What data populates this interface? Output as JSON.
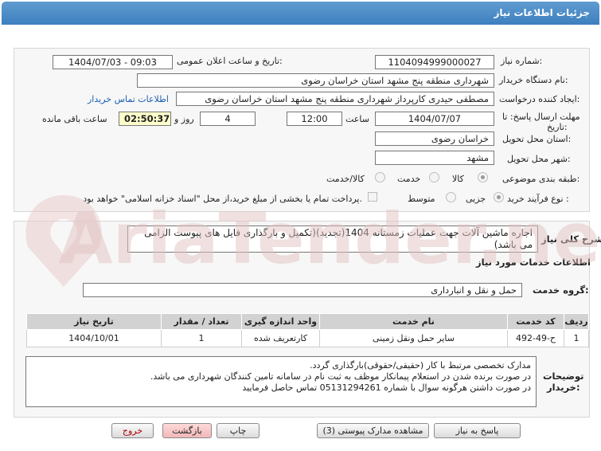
{
  "title": "جزئیات اطلاعات نیاز",
  "fields": {
    "need_number_label": "شماره نیاز:",
    "need_number": "1104094999000027",
    "announce_label": "تاریخ و ساعت اعلان عمومی:",
    "announce_value": "1404/07/03 - 09:03",
    "buyer_label": "نام دستگاه خریدار:",
    "buyer": "شهرداری منطقه پنج مشهد استان خراسان رضوی",
    "creator_label": "ایجاد کننده درخواست:",
    "creator": "مصطفی حیدری کارپرداز شهرداری منطقه پنج مشهد استان خراسان رضوی",
    "contact_link": "اطلاعات تماس خریدار",
    "deadline_label_1": "مهلت ارسال پاسخ: تا",
    "deadline_label_2": "تاریخ:",
    "deadline_date": "1404/07/07",
    "time_label": "ساعت",
    "deadline_time": "12:00",
    "days_value": "4",
    "days_label": "روز و",
    "remaining_time": "02:50:37",
    "remaining_label": "ساعت باقی مانده",
    "province_label": "استان محل تحویل:",
    "province": "خراسان رضوی",
    "city_label": "شهر محل تحویل:",
    "city": "مشهد",
    "category_label": "طبقه بندی موضوعی:",
    "category_options": [
      "کالا",
      "خدمت",
      "کالا/خدمت"
    ],
    "process_label": "نوع فرآیند خرید :",
    "process_options": [
      "جزیی",
      "متوسط"
    ],
    "payment_note": "پرداخت تمام یا بخشی از مبلغ خرید،از محل \"اسناد خزانه اسلامی\" خواهد بود."
  },
  "summary": {
    "label": "شرح کلی نیاز:",
    "text": "اجاره ماشین آلات جهت عملیات زمستانه 1404(تجدید)(تکمیل و بارگذاری فایل های پیوست الزامی می باشد)"
  },
  "services": {
    "section_title": "اطلاعات خدمات مورد نیاز",
    "group_label": "گروه خدمت:",
    "group_value": "حمل و نقل و انبارداری",
    "columns": [
      "ردیف",
      "کد خدمت",
      "نام خدمت",
      "واحد اندازه گیری",
      "تعداد / مقدار",
      "تاریخ نیاز"
    ],
    "rows": [
      [
        "1",
        "ح-49-492",
        "سایر حمل ونقل زمینی",
        "کارتعریف شده",
        "1",
        "1404/10/01"
      ]
    ]
  },
  "notes": {
    "label_1": "توضیحات",
    "label_2": "خریدار:",
    "lines": [
      "مدارک تخصصی مرتبط با کار (حقیقی/حقوقی)بارگذاری گردد.",
      "در صورت برنده شدن در استعلام پیمانکار موظف به ثبت نام در سامانه تامین کنندگان شهرداری می باشد.",
      "در صورت داشتن هرگونه سوال  با شماره 05131294261 تماس حاصل فرمایید"
    ]
  },
  "buttons": {
    "reply": "پاسخ به نیاز",
    "attachments": "مشاهده مدارک پیوستی (3)",
    "print": "چاپ",
    "back": "بازگشت",
    "exit": "خروج"
  },
  "watermark_text": "AriaTender.net",
  "colors": {
    "header": "#3d7fbf",
    "link": "#1a5fb4",
    "watermark": "#e7c7c7"
  }
}
